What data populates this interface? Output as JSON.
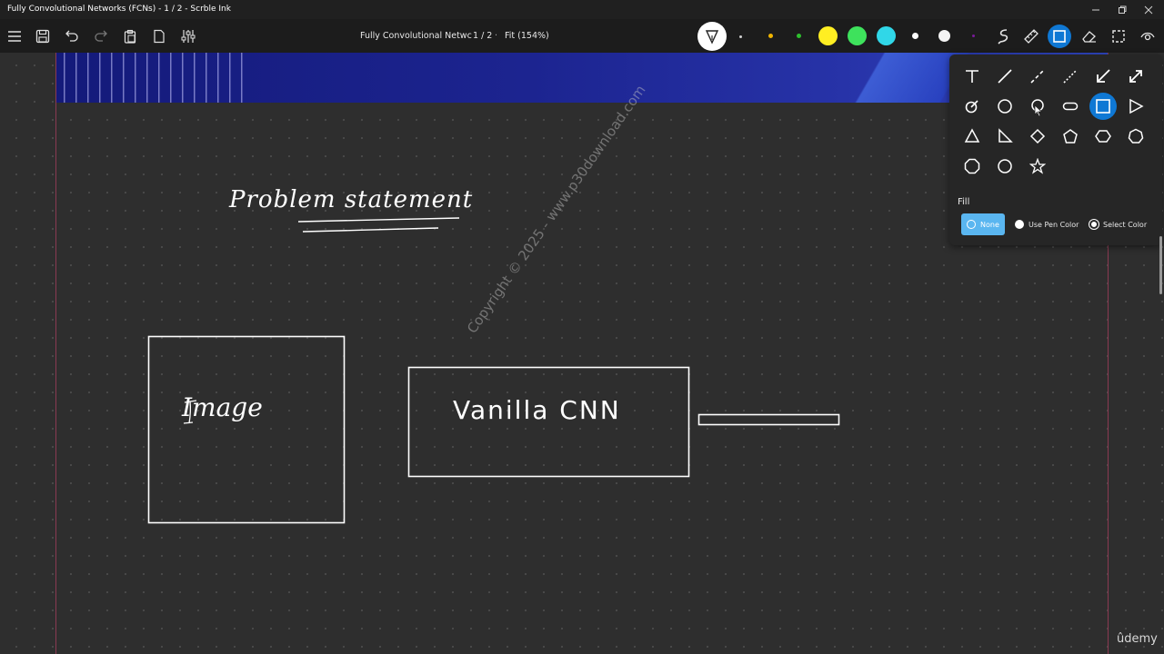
{
  "window": {
    "title": "Fully Convolutional Networks (FCNs) - 1 / 2 - Scrble Ink"
  },
  "toolbar": {
    "doc_title": "Fully Convolutional Netwc",
    "separator": "·",
    "page_indicator": "1 / 2",
    "zoom": "Fit (154%)",
    "pen_colors": [
      "#ffd21f",
      "#ffa500",
      "#3ad13a",
      "#ffee33",
      "#3ee25c",
      "#30d7e8",
      "#ffffff",
      "#f2f2f2",
      "#7a1a9a"
    ],
    "accent": "#0f78d4"
  },
  "shape_panel": {
    "fill_label": "Fill",
    "fill_options": [
      "None",
      "Use Pen Color",
      "Select Color"
    ],
    "selected_fill": "None",
    "selected_shape": "rectangle"
  },
  "canvas": {
    "heading": "Problem statement",
    "box1_label": "Image",
    "box2_label": "Vanilla CNN",
    "watermark": "Copyright © 2025 - www.p30download.com",
    "brand": "ûdemy"
  }
}
